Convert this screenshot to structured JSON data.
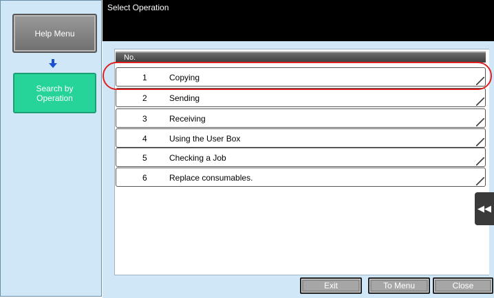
{
  "left": {
    "help_menu_label": "Help Menu",
    "search_by_operation_label": "Search by\nOperation",
    "arrow_icon": "down-arrow-icon"
  },
  "title": "Select Operation",
  "list": {
    "header": "No.",
    "rows": [
      {
        "num": "1",
        "label": "Copying"
      },
      {
        "num": "2",
        "label": "Sending"
      },
      {
        "num": "3",
        "label": "Receiving"
      },
      {
        "num": "4",
        "label": "Using the User Box"
      },
      {
        "num": "5",
        "label": "Checking a Job"
      },
      {
        "num": "6",
        "label": "Replace consumables."
      }
    ]
  },
  "side_tab_glyph": "◀◀",
  "buttons": {
    "exit": "Exit",
    "to_menu": "To Menu",
    "close": "Close"
  },
  "colors": {
    "panel_bg": "#cfe7f7",
    "accent_green": "#26d49a",
    "highlight_red": "#e02020"
  }
}
